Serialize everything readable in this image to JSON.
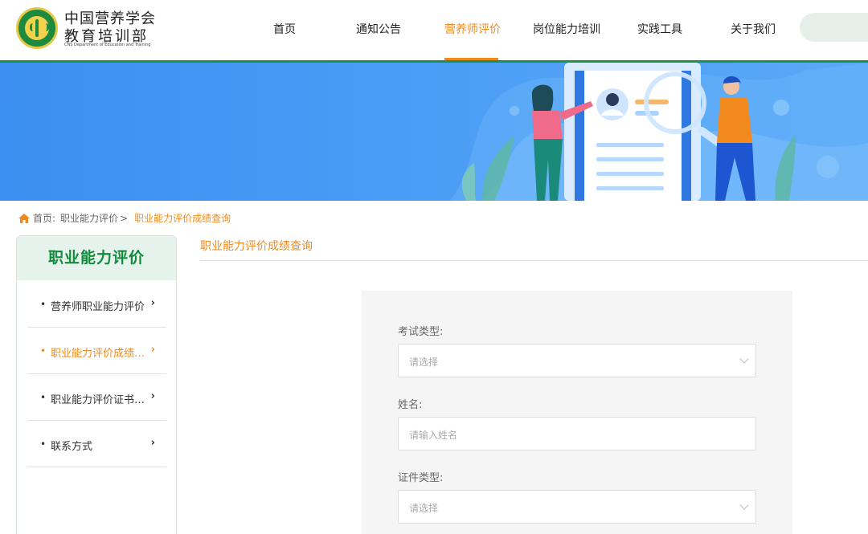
{
  "header": {
    "org_name_line1": "中国营养学会",
    "org_name_line2": "教育培训部",
    "org_name_en": "CNS Department of Education and Training",
    "logo_text": "中国营养学会"
  },
  "nav": {
    "items": [
      {
        "label": "首页"
      },
      {
        "label": "通知公告"
      },
      {
        "label": "营养师评价"
      },
      {
        "label": "岗位能力培训"
      },
      {
        "label": "实践工具"
      },
      {
        "label": "关于我们"
      }
    ],
    "active_index": 2
  },
  "breadcrumb": {
    "home": "首页:",
    "level1": "职业能力评价",
    "separator": ">",
    "current": "职业能力评价成绩查询"
  },
  "sidebar": {
    "title": "职业能力评价",
    "items": [
      {
        "label": "营养师职业能力评价"
      },
      {
        "label": "职业能力评价成绩查询"
      },
      {
        "label": "职业能力评价证书查询"
      },
      {
        "label": "联系方式"
      }
    ],
    "active_index": 1
  },
  "content": {
    "title": "职业能力评价成绩查询"
  },
  "form": {
    "exam_type_label": "考试类型:",
    "exam_type_placeholder": "请选择",
    "name_label": "姓名:",
    "name_placeholder": "请输入姓名",
    "id_type_label": "证件类型:",
    "id_type_placeholder": "请选择"
  },
  "colors": {
    "accent": "#f08a1c",
    "brand_green": "#128a3c",
    "banner_blue": "#3a8ff0"
  }
}
